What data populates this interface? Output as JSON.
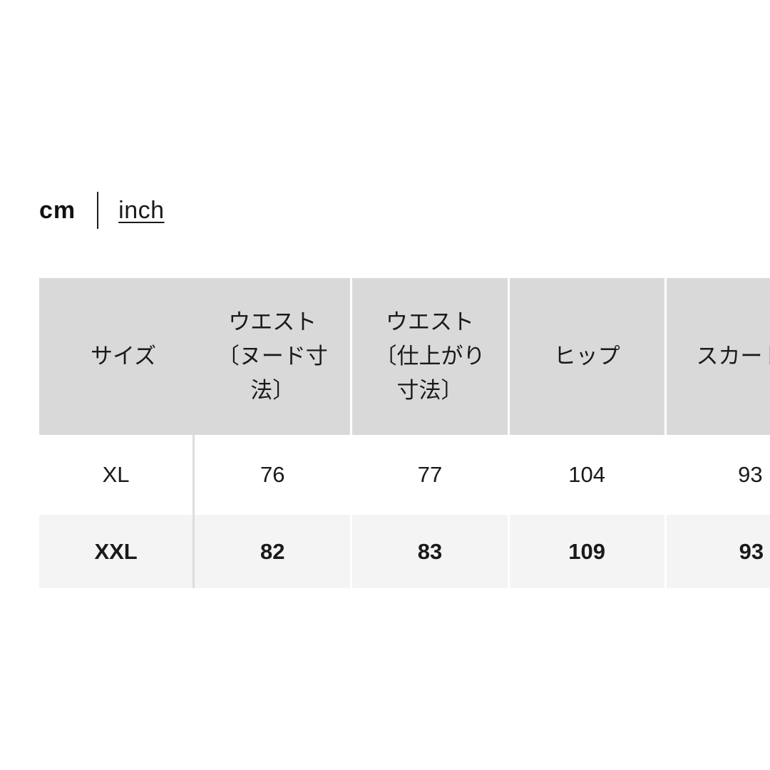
{
  "units": {
    "selected": "cm",
    "active_label": "cm",
    "link_label": "inch"
  },
  "size_table": {
    "headers": [
      "サイズ",
      "ウエスト〔ヌード寸法〕",
      "ウエスト〔仕上がり寸法〕",
      "ヒップ",
      "スカート丈"
    ],
    "rows": [
      {
        "size": "XL",
        "highlighted": false,
        "values": [
          "76",
          "77",
          "104",
          "93"
        ]
      },
      {
        "size": "XXL",
        "highlighted": true,
        "values": [
          "82",
          "83",
          "109",
          "93"
        ]
      }
    ]
  },
  "colors": {
    "header_bg": "#d9d9d9",
    "row_bg": "#ffffff",
    "row_highlight_bg": "#f4f4f4",
    "text": "#1a1a1a",
    "divider": "#dcdcdc"
  }
}
